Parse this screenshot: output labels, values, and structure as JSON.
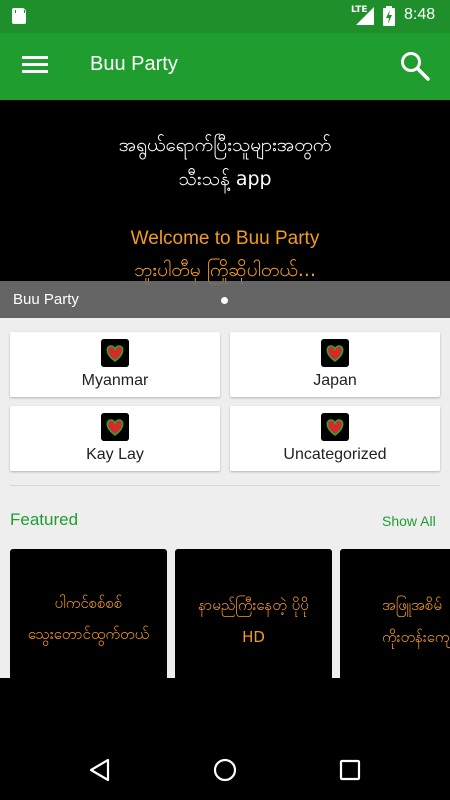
{
  "status_bar": {
    "network": "LTE",
    "battery_level": "5",
    "time": "8:48",
    "icons": [
      "sd-card-icon",
      "signal-icon",
      "battery-icon"
    ]
  },
  "app_bar": {
    "title": "Buu Party",
    "icons": [
      "menu-icon",
      "search-icon"
    ]
  },
  "banner": {
    "line1": "အရွယ်ရောက်ပြီးသူများအတွက်",
    "line2": "သီးသန့် app",
    "line3": "Welcome to Buu Party",
    "line4": "ဘူးပါတီမှ ကြိုဆိုပါတယ်...",
    "caption": "Buu Party",
    "slide_index": 1,
    "slide_count": 1
  },
  "categories": [
    {
      "label": "Myanmar"
    },
    {
      "label": "Japan"
    },
    {
      "label": "Kay Lay"
    },
    {
      "label": "Uncategorized"
    }
  ],
  "featured": {
    "title": "Featured",
    "show_all": "Show All",
    "items": [
      {
        "line1": "ပါကင်စစ်စစ်",
        "line2": "သွေးတောင်ထွက်တယ်"
      },
      {
        "line1": "နာမည်ကြီးနေတဲ့ ပိုပို",
        "line2": "HD"
      },
      {
        "line1": "အဖြူအစိမ်",
        "line2": "ကိုးတန်းကျော"
      }
    ]
  },
  "colors": {
    "primary": "#1f9d2e",
    "status_bar": "#1f8f2b",
    "accent_orange": "#f39c1e",
    "background": "#eeeeee"
  }
}
